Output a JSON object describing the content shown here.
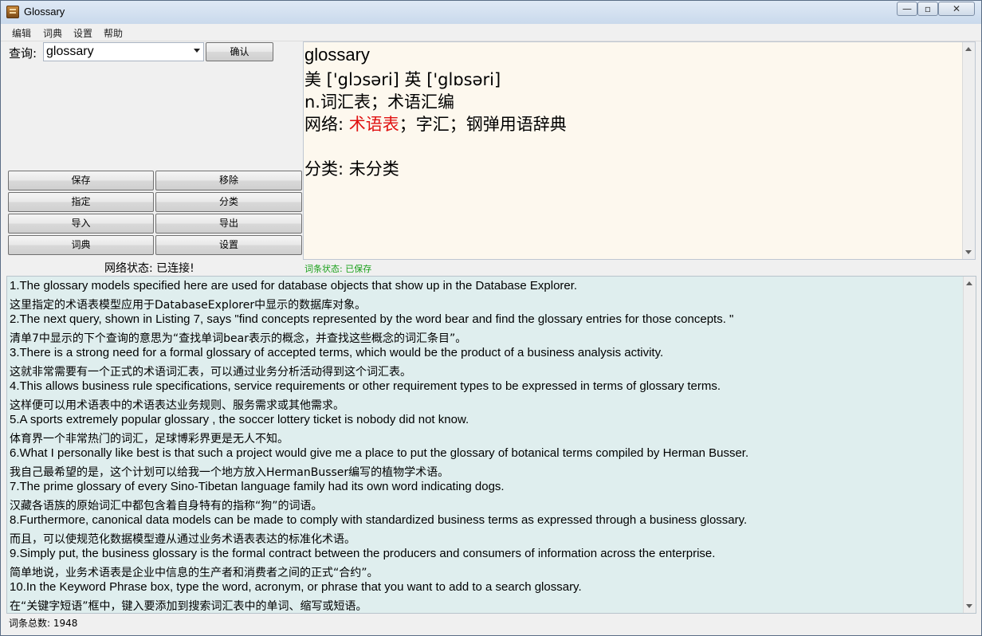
{
  "window": {
    "title": "Glossary",
    "controls": {
      "minimize": "—",
      "maximize": "▫",
      "close": "✕"
    }
  },
  "menu": [
    "编辑",
    "词典",
    "设置",
    "帮助"
  ],
  "search": {
    "label": "查询:",
    "value": "glossary",
    "confirm_label": "确认"
  },
  "buttons": {
    "save": "保存",
    "remove": "移除",
    "assign": "指定",
    "classify": "分类",
    "import": "导入",
    "export": "导出",
    "dictionary": "词典",
    "settings": "设置"
  },
  "definition": {
    "word": "glossary",
    "phonetic": "美 ['glɔsəri] 英 ['glɒsəri]",
    "meaning": "n.词汇表；术语汇编",
    "web_label": "网络: ",
    "web_highlight": "术语表",
    "web_rest": "；字汇；钢弹用语辞典",
    "category": "分类: 未分类"
  },
  "status": {
    "network": "网络状态: 已连接!",
    "entry": "词条状态: 已保存",
    "total": "词条总数: 1948"
  },
  "examples": [
    {
      "en": "1.The glossary models specified here are used for database objects that show up in the Database Explorer.",
      "cn": "这里指定的术语表模型应用于DatabaseExplorer中显示的数据库对象。"
    },
    {
      "en": "2.The next query, shown in Listing 7, says \"find concepts represented by the word bear and find the glossary entries for those concepts. \"",
      "cn": "清单7中显示的下个查询的意思为“查找单词bear表示的概念，并查找这些概念的词汇条目”。"
    },
    {
      "en": "3.There is a strong need for a formal glossary of accepted terms, which would be the product of a business analysis activity.",
      "cn": "这就非常需要有一个正式的术语词汇表，可以通过业务分析活动得到这个词汇表。"
    },
    {
      "en": "4.This allows business rule specifications, service requirements or other requirement types to be expressed in terms of glossary terms.",
      "cn": "这样便可以用术语表中的术语表达业务规则、服务需求或其他需求。"
    },
    {
      "en": "5.A sports extremely popular glossary , the soccer lottery ticket is nobody did not know.",
      "cn": "体育界一个非常热门的词汇，足球博彩界更是无人不知。"
    },
    {
      "en": "6.What I personally like best is that such a project would give me a place to put the glossary of botanical terms compiled by Herman Busser.",
      "cn": "我自己最希望的是，这个计划可以给我一个地方放入HermanBusser编写的植物学术语。"
    },
    {
      "en": "7.The prime glossary of every Sino-Tibetan language family had its own word indicating dogs.",
      "cn": "汉藏各语族的原始词汇中都包含着自身特有的指称“狗”的词语。"
    },
    {
      "en": "8.Furthermore, canonical data models can be made to comply with standardized business terms as expressed through a business glossary.",
      "cn": "而且，可以使规范化数据模型遵从通过业务术语表表达的标准化术语。"
    },
    {
      "en": "9.Simply put, the business glossary is the formal contract between the producers and consumers of information across the enterprise.",
      "cn": "简单地说，业务术语表是企业中信息的生产者和消费者之间的正式“合约”。"
    },
    {
      "en": "10.In the Keyword Phrase box, type the word, acronym, or phrase that you want to add to a search glossary.",
      "cn": "在“关键字短语”框中，键入要添加到搜索词汇表中的单词、缩写或短语。"
    }
  ]
}
